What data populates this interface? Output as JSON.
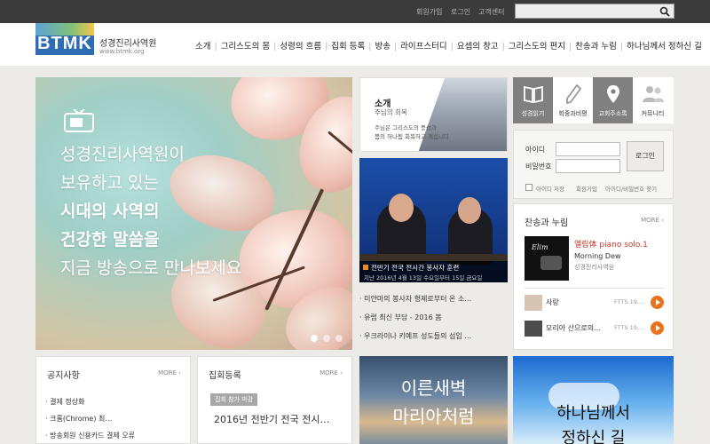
{
  "topbar": {
    "links": [
      "회원가입",
      "로그인",
      "고객센터"
    ]
  },
  "logo": {
    "mark": "BTMK",
    "name": "성경진리사역원",
    "url": "www.btmk.org"
  },
  "nav": [
    "소개",
    "그리스도의 몸",
    "성령의 흐름",
    "집회 등록",
    "방송",
    "라이프스터디",
    "요셉의 창고",
    "그리스도의 편지",
    "찬송과 누림",
    "하나님께서 정하신 길"
  ],
  "hero": {
    "lines": [
      "성경진리사역원이",
      "보유하고 있는",
      "시대의 사역의",
      "건강한 말씀을",
      "지금 방송으로 만나보세요"
    ]
  },
  "intro": {
    "title": "소개",
    "subtitle": "주님의 회복",
    "desc1": "주님은 그리스도의 풍성과",
    "desc2": "몸의 하나됨 회복하고 계십니다"
  },
  "video": {
    "caption1": "전반기 전국 전시간 봉사자 훈련",
    "caption2": "지난 2016년 4월 13일 수요일부터 15일 금요일"
  },
  "news": [
    "미얀마의 봉사자 형제로부터 온 소…",
    "유럽 최신 부담 - 2016 봄",
    "우크라이나 키예프 성도들의 섬임 …"
  ],
  "quick": [
    {
      "icon": "book-icon",
      "label": "성경읽기",
      "active": true
    },
    {
      "icon": "pen-icon",
      "label": "회중과비평",
      "active": false
    },
    {
      "icon": "map-pin-icon",
      "label": "교회주소록",
      "active": true
    },
    {
      "icon": "people-icon",
      "label": "커뮤니티",
      "active": false
    }
  ],
  "login": {
    "id_label": "아이디",
    "pw_label": "비밀번호",
    "button": "로그인",
    "save": "아이디 저장",
    "join": "회원가입",
    "find": "아이디/비밀번호 찾기"
  },
  "music": {
    "title": "찬송과 누림",
    "more": "MORE",
    "featured_title": "엘림体 piano solo.1",
    "featured_sub": "Morning Dew",
    "featured_org": "성경진리사역원",
    "album_text": "Elim",
    "tracks": [
      {
        "title": "사랑",
        "code": "FTTS 19,…"
      },
      {
        "title": "모리아 산으로의…",
        "code": "FTTS 19,…"
      }
    ]
  },
  "notice": {
    "title": "공지사항",
    "more": "MORE",
    "items": [
      "결제 정상화",
      "크롬(Chrome) 최…",
      "방송회원 신용카드 결제 오류"
    ]
  },
  "meeting": {
    "title": "집회등록",
    "more": "MORE",
    "badge": "집회 참가 마감",
    "headline": "2016년 전반기 전국 전시…"
  },
  "banner1": {
    "line1": "이른새벽",
    "line2": "마리아처럼"
  },
  "banner2": {
    "line1": "하나님께서",
    "line2": "정하신 길"
  },
  "colors": {
    "topbar": "#3b3b3b",
    "accent": "#e8731c",
    "brand_blue": "#2e6db4"
  }
}
